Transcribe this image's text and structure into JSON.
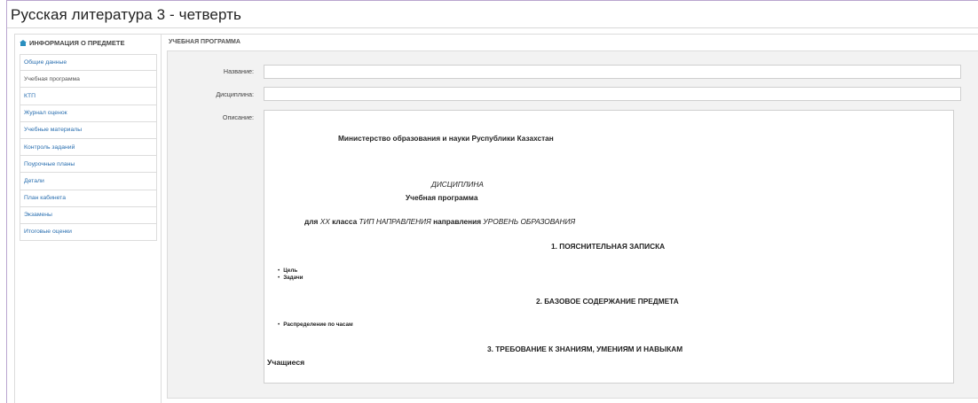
{
  "page": {
    "title": "Русская литература 3 - четверть"
  },
  "sidebar": {
    "header": "ИНФОРМАЦИЯ О ПРЕДМЕТЕ",
    "header_icon": "home-icon",
    "items": [
      {
        "label": "Общие данные"
      },
      {
        "label": "Учебная программа"
      },
      {
        "label": "КТП"
      },
      {
        "label": "Журнал оценок"
      },
      {
        "label": "Учебные материалы"
      },
      {
        "label": "Контроль заданий"
      },
      {
        "label": "Поурочные планы"
      },
      {
        "label": "Детали"
      },
      {
        "label": "План кабинета"
      },
      {
        "label": "Экзамены"
      },
      {
        "label": "Итоговые оценки"
      }
    ],
    "active_index": 1,
    "link_color": "#2a6fb0"
  },
  "main": {
    "header": "УЧЕБНАЯ ПРОГРАММА",
    "fields": {
      "name_label": "Название:",
      "name_value": "",
      "discipline_label": "Дисциплина:",
      "discipline_value": "",
      "description_label": "Описание:"
    },
    "description": {
      "ministry": "Министерство образования и науки Руспублики Казахстан",
      "discipline": "ДИСЦИПЛИНА",
      "program": "Учебная программа",
      "for_prefix": "для",
      "class_var": "XX",
      "class_word": "класса",
      "direction_var": "ТИП НАПРАВЛЕНИЯ",
      "direction_word": "направления",
      "level_var": "УРОВЕНЬ ОБРАЗОВАНИЯ",
      "section1": "1. ПОЯСНИТЕЛЬНАЯ ЗАПИСКА",
      "section1_items": [
        "Цель",
        "Задачи"
      ],
      "section2": "2. БАЗОВОЕ СОДЕРЖАНИЕ ПРЕДМЕТА",
      "section2_items": [
        "Распределение по часам"
      ],
      "section3": "3. ТРЕБОВАНИЕ К ЗНАНИЯМ, УМЕНИЯМ И НАВЫКАМ",
      "students": "Учащиеся"
    }
  }
}
